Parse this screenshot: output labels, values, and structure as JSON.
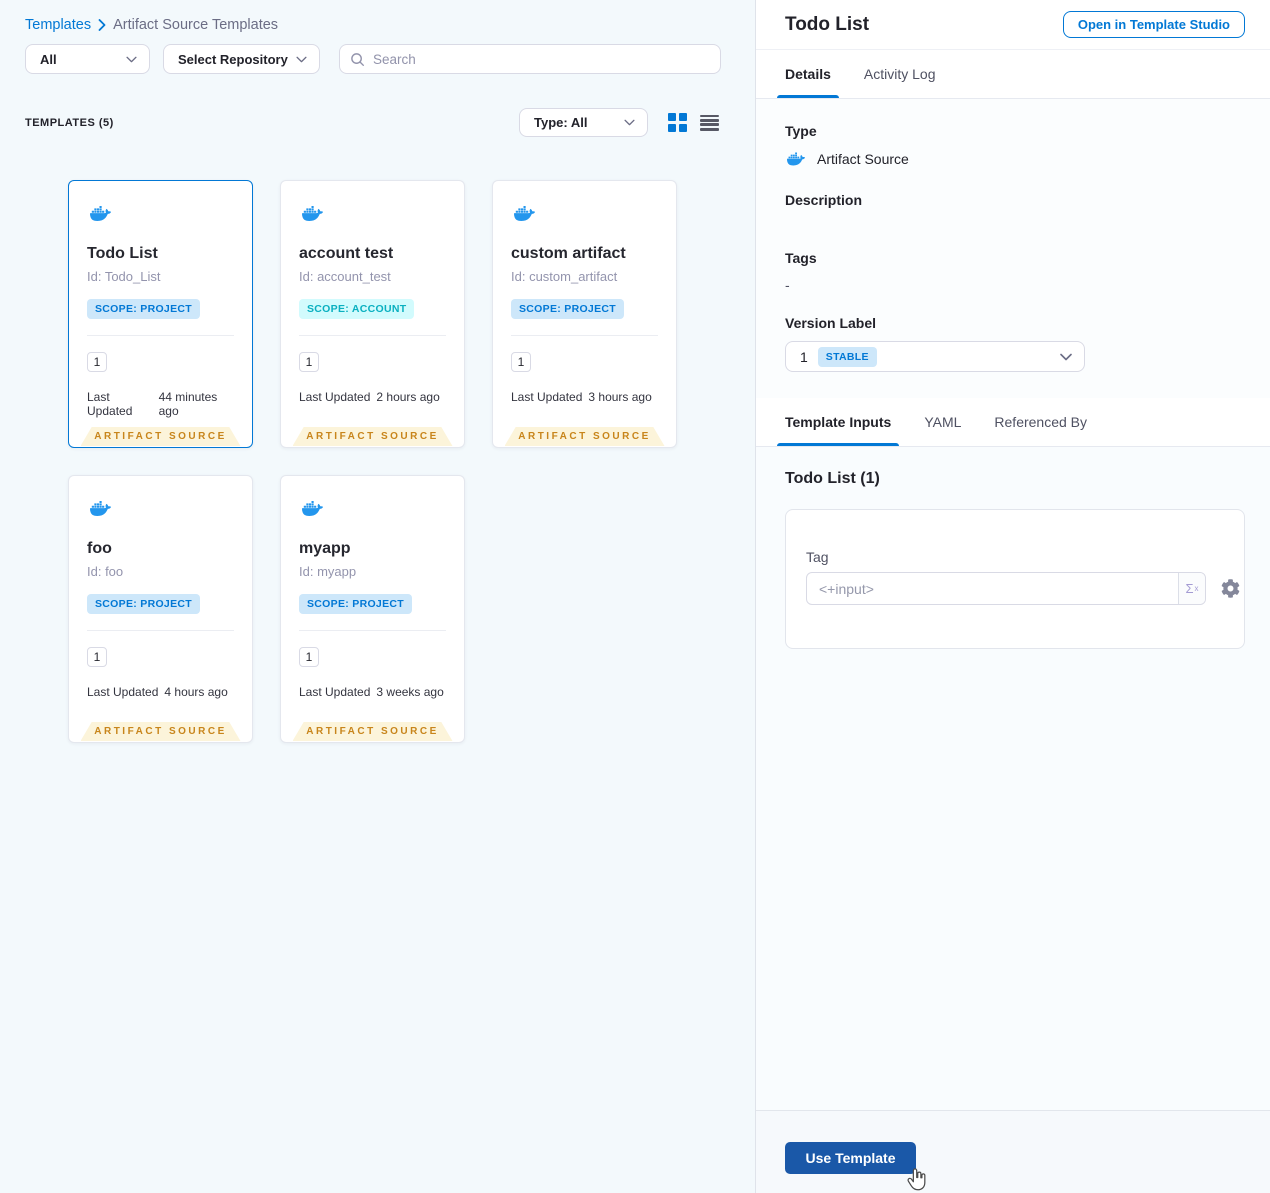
{
  "breadcrumb": {
    "root": "Templates",
    "current": "Artifact Source Templates"
  },
  "filters": {
    "scope_dropdown": "All",
    "repo_dropdown": "Select Repository",
    "search_placeholder": "Search"
  },
  "toolbar": {
    "count_label": "TEMPLATES (5)",
    "type_dropdown": "Type: All"
  },
  "cards": [
    {
      "title": "Todo List",
      "id": "Id: Todo_List",
      "scope": "SCOPE: PROJECT",
      "version": "1",
      "updated_label": "Last Updated",
      "updated_value": "44 minutes ago",
      "ribbon": "ARTIFACT SOURCE"
    },
    {
      "title": "account test",
      "id": "Id: account_test",
      "scope": "SCOPE: ACCOUNT",
      "version": "1",
      "updated_label": "Last Updated",
      "updated_value": "2 hours ago",
      "ribbon": "ARTIFACT SOURCE"
    },
    {
      "title": "custom artifact",
      "id": "Id: custom_artifact",
      "scope": "SCOPE: PROJECT",
      "version": "1",
      "updated_label": "Last Updated",
      "updated_value": "3 hours ago",
      "ribbon": "ARTIFACT SOURCE"
    },
    {
      "title": "foo",
      "id": "Id: foo",
      "scope": "SCOPE: PROJECT",
      "version": "1",
      "updated_label": "Last Updated",
      "updated_value": "4 hours ago",
      "ribbon": "ARTIFACT SOURCE"
    },
    {
      "title": "myapp",
      "id": "Id: myapp",
      "scope": "SCOPE: PROJECT",
      "version": "1",
      "updated_label": "Last Updated",
      "updated_value": "3 weeks ago",
      "ribbon": "ARTIFACT SOURCE"
    }
  ],
  "panel": {
    "title": "Todo List",
    "open_studio_button": "Open in Template Studio",
    "tabs": [
      "Details",
      "Activity Log"
    ],
    "details": {
      "type_label": "Type",
      "type_value": "Artifact Source",
      "description_label": "Description",
      "tags_label": "Tags",
      "tags_value": "-",
      "version_label": "Version Label",
      "version_value": "1",
      "version_badge": "STABLE"
    },
    "sub_tabs": [
      "Template Inputs",
      "YAML",
      "Referenced By"
    ],
    "inputs": {
      "heading": "Todo List (1)",
      "tag_label": "Tag",
      "tag_value": "<+input>",
      "expression_symbol": "Σ",
      "expression_sup": "x"
    },
    "use_template_button": "Use Template"
  },
  "icons": {
    "breadcrumb_separator": "chevron-right-icon",
    "search": "search-icon",
    "dropdowns": "chevron-down-icon",
    "grid_view": "grid-view-icon",
    "list_view": "list-view-icon",
    "template_type": "docker-icon",
    "expression": "sigma-icon",
    "settings": "gear-icon",
    "pointer": "hand-pointer-cursor"
  },
  "colors": {
    "accent_blue": "#0278d5",
    "docker_blue": "#2396ed",
    "use_template_blue": "#1a58a8",
    "ribbon_bg": "#fcf4da",
    "ribbon_text": "#c8851b",
    "scope_project_bg": "#cde7fa",
    "scope_project_text": "#0278d5",
    "scope_account_bg": "#d2fbfd",
    "scope_account_text": "#0ab0c0",
    "stable_bg": "#cde7fa",
    "stable_text": "#0278d5",
    "left_panel_bg": "#f3f9fc"
  }
}
